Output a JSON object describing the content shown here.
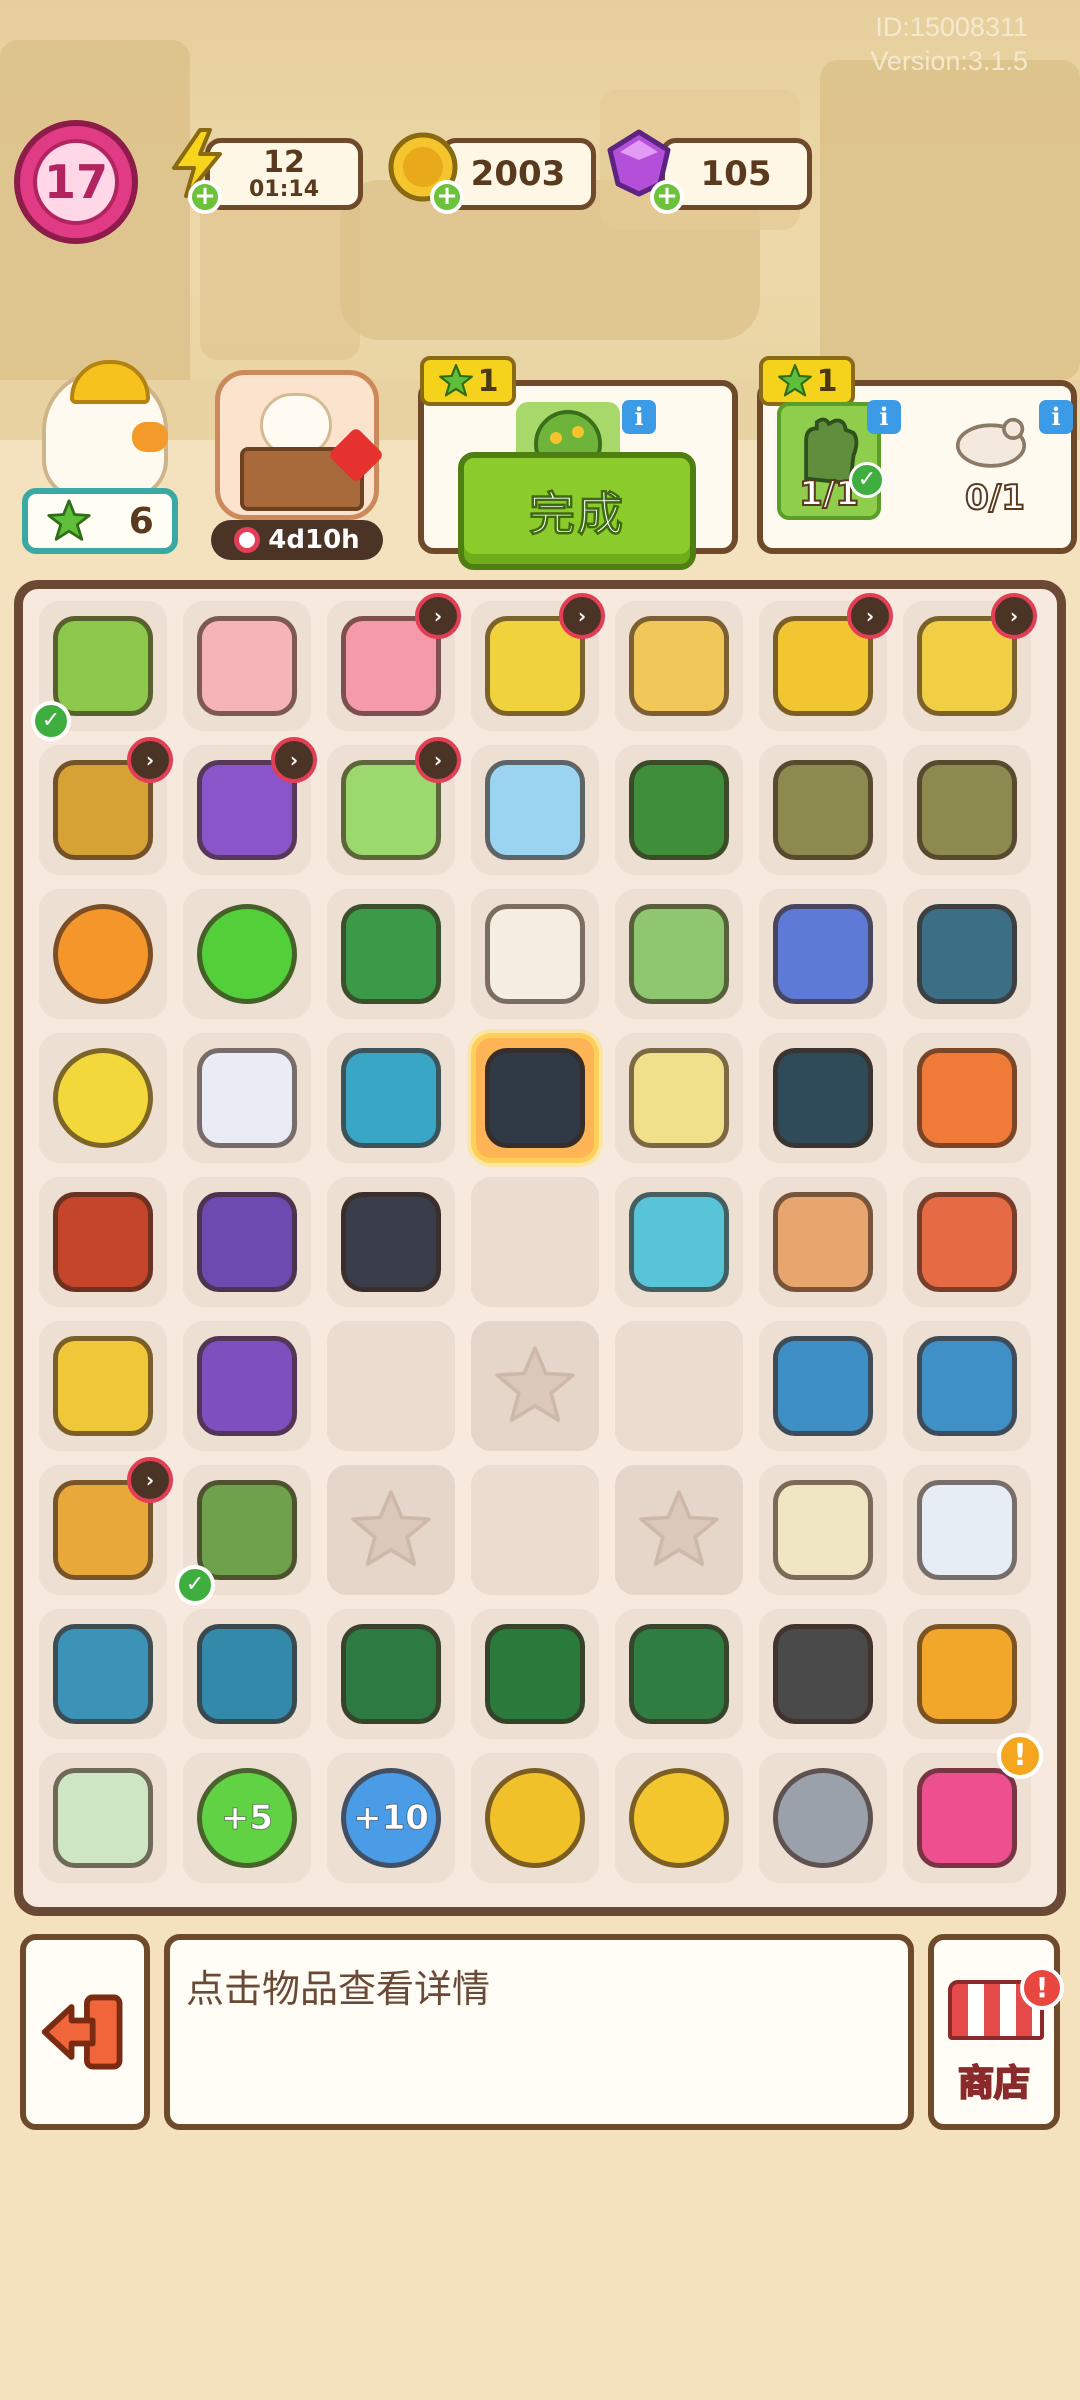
{
  "header": {
    "id_text": "ID:15008311",
    "version_text": "Version:3.1.5"
  },
  "resources": {
    "level": "17",
    "energy_value": "12",
    "energy_timer": "01:14",
    "coins": "2003",
    "gems": "105"
  },
  "player": {
    "stars": "6"
  },
  "event": {
    "timer": "4d10h"
  },
  "orders": [
    {
      "reward": "1",
      "progress": "",
      "button": "完成"
    },
    {
      "reward": "1",
      "progress_a": "1/1",
      "progress_b": "0/1"
    }
  ],
  "board": {
    "rows": [
      [
        {
          "name": "potted-plant",
          "color": "#8cc84b",
          "timer": false,
          "done": true
        },
        {
          "name": "pink-thermos",
          "color": "#f7b4b8",
          "timer": false
        },
        {
          "name": "pink-fridge",
          "color": "#f59aa8",
          "timer": true
        },
        {
          "name": "tool-cart",
          "color": "#f0d23c",
          "timer": true
        },
        {
          "name": "plant-pot",
          "color": "#f2c75a",
          "timer": false
        },
        {
          "name": "shopping-cart-full",
          "color": "#f1c630",
          "timer": true
        },
        {
          "name": "shopping-cart",
          "color": "#f0cf44",
          "timer": true
        }
      ],
      [
        {
          "name": "cabinet",
          "color": "#d6a236",
          "timer": true
        },
        {
          "name": "purple-basket",
          "color": "#8a55c9",
          "timer": true
        },
        {
          "name": "laptop",
          "color": "#9bd86e",
          "timer": true
        },
        {
          "name": "printer",
          "color": "#9bd4f0",
          "timer": false
        },
        {
          "name": "green-toolbox-open",
          "color": "#3f8f3a",
          "timer": false
        },
        {
          "name": "sandbags",
          "color": "#8c8a4e",
          "timer": false
        },
        {
          "name": "sandbags-stack",
          "color": "#8d8a4f",
          "timer": false
        }
      ],
      [
        {
          "name": "orange-energy",
          "color": "#f5962b",
          "round": true
        },
        {
          "name": "green-energy",
          "color": "#53cf3a",
          "round": true
        },
        {
          "name": "drill",
          "color": "#3a9a47"
        },
        {
          "name": "bandage-box",
          "color": "#f4eee0"
        },
        {
          "name": "green-gloves",
          "color": "#8ec770"
        },
        {
          "name": "neck-pillow",
          "color": "#5d7bd6"
        },
        {
          "name": "ab-wheel",
          "color": "#3c6e86"
        }
      ],
      [
        {
          "name": "yellow-energy",
          "color": "#f2d83a",
          "round": true
        },
        {
          "name": "spray-bottle",
          "color": "#e9ecf5"
        },
        {
          "name": "jump-rope",
          "color": "#3aa6c6"
        },
        {
          "name": "hand-grip",
          "color": "#2f3a46",
          "selected": true
        },
        {
          "name": "yarn-ball",
          "color": "#f1e08b"
        },
        {
          "name": "weight-plate",
          "color": "#2f4a58"
        },
        {
          "name": "apple-core",
          "color": "#f07b39"
        }
      ],
      [
        {
          "name": "sling-bag",
          "color": "#c4452a"
        },
        {
          "name": "purple-hanger",
          "color": "#6c4ab0"
        },
        {
          "name": "boxing-glove",
          "color": "#3a3d4a"
        },
        {
          "name": "empty",
          "type": "empty"
        },
        {
          "name": "blue-ribbon",
          "color": "#57c4d8"
        },
        {
          "name": "sandwich",
          "color": "#e7a66e"
        },
        {
          "name": "soda-can",
          "color": "#e66a44"
        }
      ],
      [
        {
          "name": "cardboard-box",
          "color": "#f1c73a"
        },
        {
          "name": "purple-basket-2",
          "color": "#7d4fbf"
        },
        {
          "name": "empty",
          "type": "empty"
        },
        {
          "name": "locked-star",
          "type": "star"
        },
        {
          "name": "empty",
          "type": "empty"
        },
        {
          "name": "cpu-chip",
          "color": "#3f8fc7"
        },
        {
          "name": "capacitor",
          "color": "#3f90c6"
        }
      ],
      [
        {
          "name": "tote-bag",
          "color": "#e9a93a",
          "timer": true
        },
        {
          "name": "work-gloves",
          "color": "#6fa14c",
          "done": true
        },
        {
          "name": "locked-star",
          "type": "star"
        },
        {
          "name": "empty",
          "type": "empty"
        },
        {
          "name": "locked-star",
          "type": "star"
        },
        {
          "name": "line-chart-notepad",
          "color": "#f0e6c4"
        },
        {
          "name": "bar-chart-notepad",
          "color": "#e6edf5"
        }
      ],
      [
        {
          "name": "blue-puzzle",
          "color": "#3c93b8"
        },
        {
          "name": "blue-tiles",
          "color": "#3389a9"
        },
        {
          "name": "green-handle",
          "color": "#2e7a43"
        },
        {
          "name": "green-toolbox",
          "color": "#2a7a3c"
        },
        {
          "name": "green-toolbox-2",
          "color": "#307d42"
        },
        {
          "name": "caster-wheel",
          "color": "#4a4a4a"
        },
        {
          "name": "recipe-book",
          "color": "#f2a62a"
        }
      ],
      [
        {
          "name": "brochure",
          "color": "#cfe6c2"
        },
        {
          "name": "plus-5-energy",
          "color": "#62d245",
          "round": true,
          "label": "+5"
        },
        {
          "name": "plus-10-energy",
          "color": "#4a9ce6",
          "round": true,
          "label": "+10"
        },
        {
          "name": "coin-pile",
          "color": "#f1c12a",
          "round": true
        },
        {
          "name": "coin-stack",
          "color": "#f3c62e",
          "round": true
        },
        {
          "name": "snail-shell",
          "color": "#9aa1aa",
          "round": true
        },
        {
          "name": "pink-backpack",
          "color": "#ee4f8e",
          "alert": true
        }
      ]
    ]
  },
  "footer": {
    "info_text": "点击物品查看详情",
    "shop_label": "商店"
  },
  "colors": {
    "frame": "#6b4a35",
    "complete_green": "#8bcb2c",
    "level_pink": "#e23b86"
  }
}
